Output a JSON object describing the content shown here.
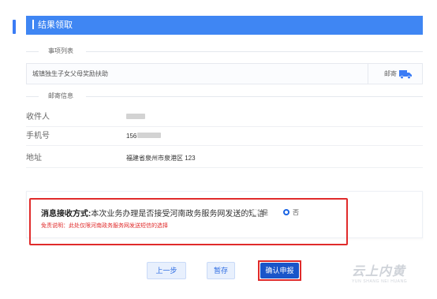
{
  "section": {
    "title": "结果领取"
  },
  "item_list": {
    "label": "事项列表",
    "items": [
      {
        "name": "城镇独生子女父母奖励扶助",
        "delivery": "邮寄",
        "delivery_icon": "truck-icon"
      }
    ]
  },
  "mail_info": {
    "label": "邮寄信息",
    "rows": [
      {
        "key": "收件人",
        "value": ""
      },
      {
        "key": "手机号",
        "value": "156"
      },
      {
        "key": "地址",
        "value": "福建省泉州市泉港区 123"
      }
    ]
  },
  "message": {
    "title_bold": "消息接收方式:",
    "question": "本次业务办理是否接受河南政务服务网发送的短信",
    "option_yes": "是",
    "option_no": "否",
    "selected": "否",
    "disclaimer": "免责说明：此处仅限河南政务服务网发送短信的选择"
  },
  "buttons": {
    "prev": "上一步",
    "save": "暂存",
    "submit": "确认申报"
  },
  "watermark": {
    "cn": "云上内黄",
    "en": "YUN SHANG NEI HUANG"
  },
  "colors": {
    "accent": "#3f86f3",
    "highlight": "#e02b2b",
    "primary_button": "#1a55c9"
  }
}
